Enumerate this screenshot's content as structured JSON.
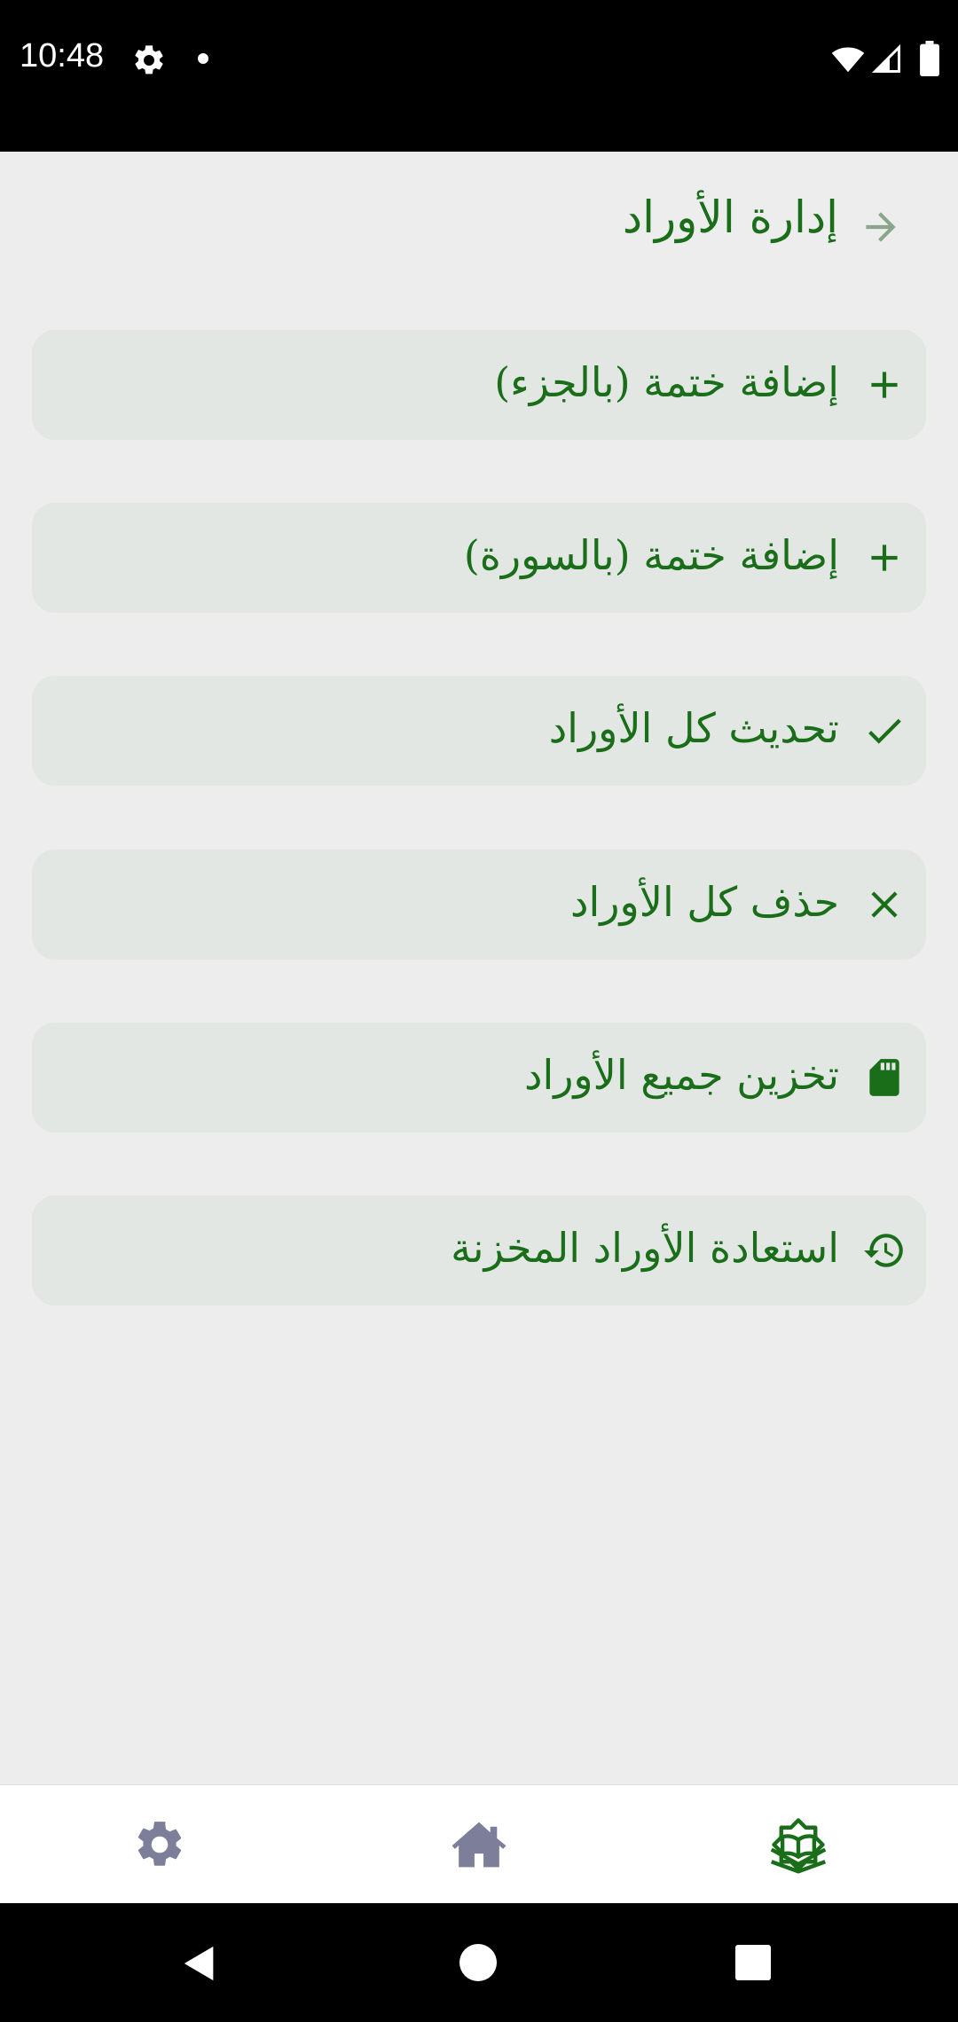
{
  "status_bar": {
    "time": "10:48"
  },
  "header": {
    "title": "إدارة الأوراد",
    "back_icon": "arrow-right-icon"
  },
  "actions": [
    {
      "label": "إضافة ختمة (بالجزء)",
      "icon": "plus-icon"
    },
    {
      "label": "إضافة ختمة (بالسورة)",
      "icon": "plus-icon"
    },
    {
      "label": "تحديث كل الأوراد",
      "icon": "check-icon"
    },
    {
      "label": "حذف كل الأوراد",
      "icon": "close-icon"
    },
    {
      "label": "تخزين جميع الأوراد",
      "icon": "sd-card-icon"
    },
    {
      "label": "استعادة الأوراد المخزنة",
      "icon": "history-icon"
    }
  ],
  "bottom_nav": {
    "items": [
      {
        "icon": "gear-icon",
        "active": false
      },
      {
        "icon": "home-icon",
        "active": false
      },
      {
        "icon": "quran-book-icon",
        "active": true
      }
    ]
  },
  "colors": {
    "accent": "#1a6e1a",
    "card_bg": "#e3e7e3",
    "page_bg": "#ededed",
    "nav_inactive": "#7d7f9a"
  }
}
